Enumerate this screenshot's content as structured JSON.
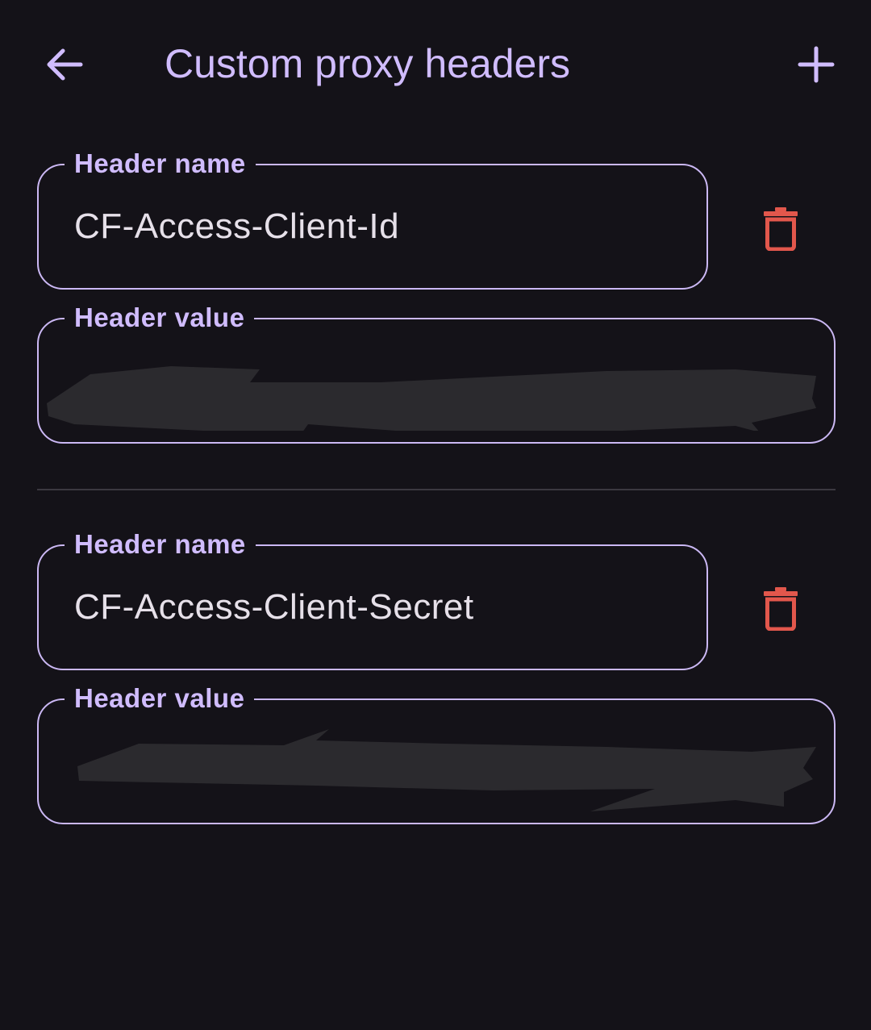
{
  "header": {
    "title": "Custom proxy headers",
    "back_icon": "arrow-left-icon",
    "add_icon": "plus-icon"
  },
  "headers": [
    {
      "name_label": "Header name",
      "name_value": "CF-Access-Client-Id",
      "value_label": "Header value",
      "value_value": "",
      "delete_icon": "trash-icon"
    },
    {
      "name_label": "Header name",
      "name_value": "CF-Access-Client-Secret",
      "value_label": "Header value",
      "value_value": "",
      "delete_icon": "trash-icon"
    }
  ],
  "colors": {
    "background": "#141218",
    "accent": "#d0bcfe",
    "outline": "#cbb8f4",
    "text": "#e6e0e9",
    "delete": "#e2574c",
    "divider": "#3b3840"
  }
}
